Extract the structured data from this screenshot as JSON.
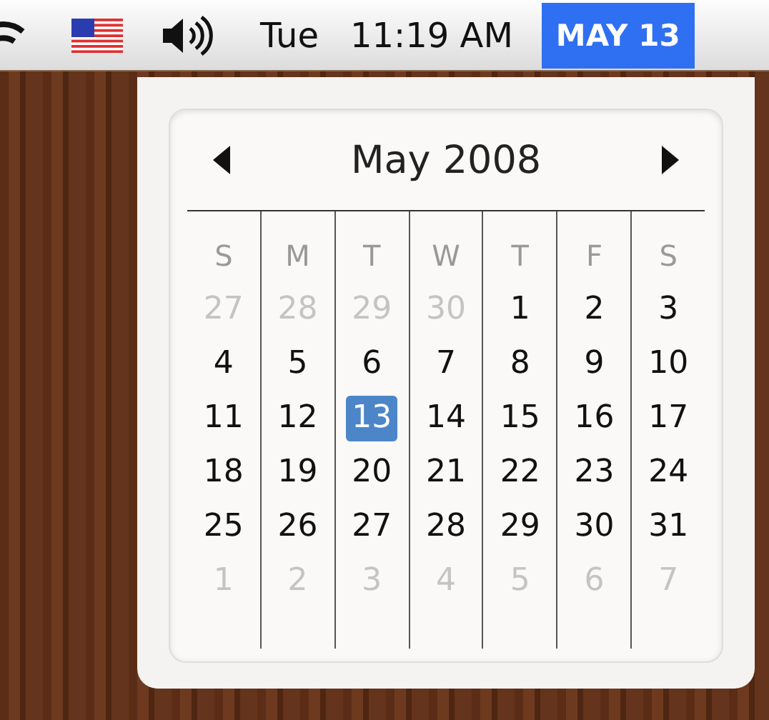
{
  "menu_bar": {
    "day": "Tue",
    "time": "11:19 AM",
    "date_button": {
      "label": "MAY 13",
      "selected": true
    }
  },
  "calendar": {
    "month": "May 2008",
    "weekdays": [
      "S",
      "M",
      "T",
      "W",
      "T",
      "F",
      "S"
    ],
    "weeks": [
      [
        {
          "label": "27",
          "muted": true,
          "selected": false
        },
        {
          "label": "28",
          "muted": true,
          "selected": false
        },
        {
          "label": "29",
          "muted": true,
          "selected": false
        },
        {
          "label": "30",
          "muted": true,
          "selected": false
        },
        {
          "label": "1",
          "muted": false,
          "selected": false
        },
        {
          "label": "2",
          "muted": false,
          "selected": false
        },
        {
          "label": "3",
          "muted": false,
          "selected": false
        }
      ],
      [
        {
          "label": "4",
          "muted": false,
          "selected": false
        },
        {
          "label": "5",
          "muted": false,
          "selected": false
        },
        {
          "label": "6",
          "muted": false,
          "selected": false
        },
        {
          "label": "7",
          "muted": false,
          "selected": false
        },
        {
          "label": "8",
          "muted": false,
          "selected": false
        },
        {
          "label": "9",
          "muted": false,
          "selected": false
        },
        {
          "label": "10",
          "muted": false,
          "selected": false
        }
      ],
      [
        {
          "label": "11",
          "muted": false,
          "selected": false
        },
        {
          "label": "12",
          "muted": false,
          "selected": false
        },
        {
          "label": "13",
          "muted": false,
          "selected": true
        },
        {
          "label": "14",
          "muted": false,
          "selected": false
        },
        {
          "label": "15",
          "muted": false,
          "selected": false
        },
        {
          "label": "16",
          "muted": false,
          "selected": false
        },
        {
          "label": "17",
          "muted": false,
          "selected": false
        }
      ],
      [
        {
          "label": "18",
          "muted": false,
          "selected": false
        },
        {
          "label": "19",
          "muted": false,
          "selected": false
        },
        {
          "label": "20",
          "muted": false,
          "selected": false
        },
        {
          "label": "21",
          "muted": false,
          "selected": false
        },
        {
          "label": "22",
          "muted": false,
          "selected": false
        },
        {
          "label": "23",
          "muted": false,
          "selected": false
        },
        {
          "label": "24",
          "muted": false,
          "selected": false
        }
      ],
      [
        {
          "label": "25",
          "muted": false,
          "selected": false
        },
        {
          "label": "26",
          "muted": false,
          "selected": false
        },
        {
          "label": "27",
          "muted": false,
          "selected": false
        },
        {
          "label": "28",
          "muted": false,
          "selected": false
        },
        {
          "label": "29",
          "muted": false,
          "selected": false
        },
        {
          "label": "30",
          "muted": false,
          "selected": false
        },
        {
          "label": "31",
          "muted": false,
          "selected": false
        }
      ],
      [
        {
          "label": "1",
          "muted": true,
          "selected": false
        },
        {
          "label": "2",
          "muted": true,
          "selected": false
        },
        {
          "label": "3",
          "muted": true,
          "selected": false
        },
        {
          "label": "4",
          "muted": true,
          "selected": false
        },
        {
          "label": "5",
          "muted": true,
          "selected": false
        },
        {
          "label": "6",
          "muted": true,
          "selected": false
        },
        {
          "label": "7",
          "muted": true,
          "selected": false
        }
      ]
    ]
  }
}
